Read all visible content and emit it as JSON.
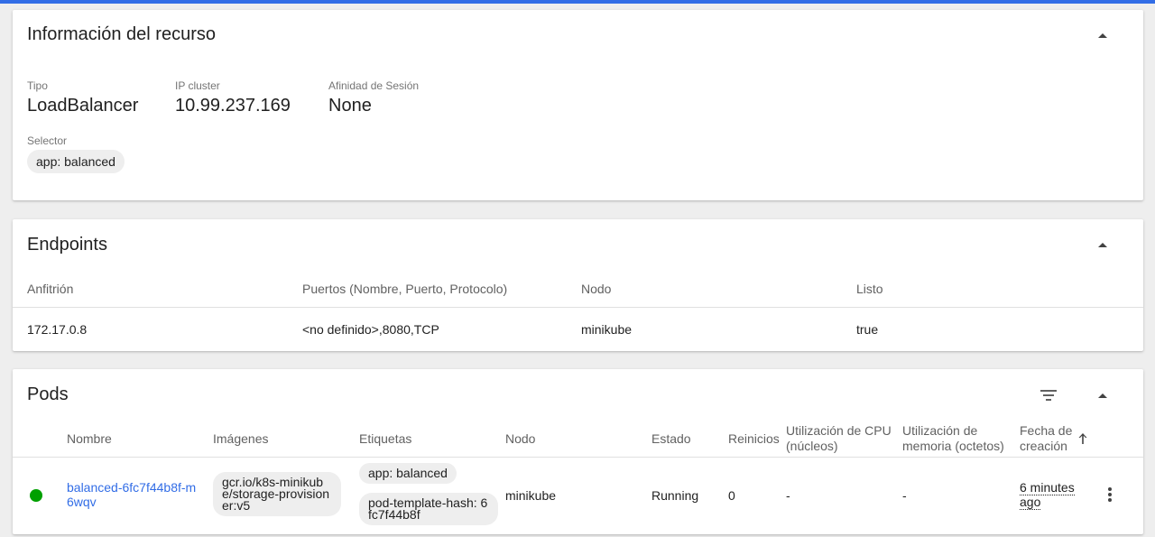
{
  "colors": {
    "accent": "#326de6",
    "status_running": "#00a000"
  },
  "resource_info": {
    "title": "Información del recurso",
    "type_label": "Tipo",
    "type_value": "LoadBalancer",
    "cluster_ip_label": "IP cluster",
    "cluster_ip_value": "10.99.237.169",
    "session_affinity_label": "Afinidad de Sesión",
    "session_affinity_value": "None",
    "selector_label": "Selector",
    "selector_chip": "app: balanced"
  },
  "endpoints": {
    "title": "Endpoints",
    "columns": [
      "Anfitrión",
      "Puertos (Nombre, Puerto, Protocolo)",
      "Nodo",
      "Listo"
    ],
    "rows": [
      {
        "host": "172.17.0.8",
        "ports": "<no definido>,8080,TCP",
        "node": "minikube",
        "ready": "true"
      }
    ]
  },
  "pods": {
    "title": "Pods",
    "columns": {
      "name": "Nombre",
      "images": "Imágenes",
      "labels": "Etiquetas",
      "node": "Nodo",
      "status": "Estado",
      "restarts": "Reinicios",
      "cpu": "Utilización de CPU (núcleos)",
      "memory": "Utilización de memoria (octetos)",
      "created": "Fecha de creación"
    },
    "rows": [
      {
        "status_icon": "running-status-icon",
        "name": "balanced-6fc7f44b8f-m6wqv",
        "image": "gcr.io/k8s-minikube/storage-provisioner:v5",
        "labels": [
          "app: balanced",
          "pod-template-hash: 6fc7f44b8f"
        ],
        "node": "minikube",
        "status": "Running",
        "restarts": "0",
        "cpu": "-",
        "memory": "-",
        "created": "6 minutes ago"
      }
    ]
  }
}
